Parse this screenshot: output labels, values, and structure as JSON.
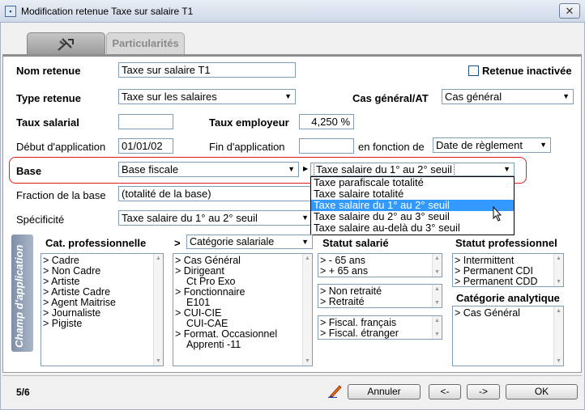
{
  "window": {
    "title": "Modification retenue Taxe sur salaire T1",
    "close_glyph": "✕"
  },
  "tabs": [
    {
      "label": "",
      "icon": "tool-icon"
    },
    {
      "label": "Particularités"
    }
  ],
  "form": {
    "nom_retenue_label": "Nom retenue",
    "nom_retenue_value": "Taxe sur salaire T1",
    "retenue_inactivee_label": "Retenue inactivée",
    "type_retenue_label": "Type retenue",
    "type_retenue_value": "Taxe sur les salaires",
    "cas_general_label": "Cas général/AT",
    "cas_general_value": "Cas général",
    "taux_salarial_label": "Taux salarial",
    "taux_salarial_value": "",
    "taux_employeur_label": "Taux employeur",
    "taux_employeur_value": "4,250 %",
    "debut_label": "Début d'application",
    "debut_value": "01/01/02",
    "fin_label": "Fin d'application",
    "fin_value": "",
    "en_fonction_label": "en fonction de",
    "en_fonction_value": "Date de règlement",
    "base_label": "Base",
    "base_value": "Base fiscale",
    "seuil_value": "Taxe salaire du 1° au 2° seuil",
    "fraction_label": "Fraction de la base",
    "fraction_value": "(totalité de la base)",
    "specificite_label": "Spécificité",
    "specificite_value": "Taxe salaire du 1° au 2° seuil"
  },
  "dropdown": {
    "items": [
      "Taxe parafiscale totalité",
      "Taxe salaire totalité",
      "Taxe salaire du 1° au 2° seuil",
      "Taxe salaire du 2° au 3° seuil",
      "Taxe salaire au-delà du 3° seuil"
    ],
    "selected_index": 2
  },
  "champ": {
    "label": "Champ d'application",
    "cat_pro_label": "Cat. professionnelle",
    "cat_pro_items": [
      "> Cadre",
      "> Non Cadre",
      "> Artiste",
      "> Artiste Cadre",
      "> Agent Maitrise",
      "> Journaliste",
      "> Pigiste"
    ],
    "cat_sal_arrow": ">",
    "cat_sal_select": "Catégorie salariale",
    "cat_sal_items": [
      "> Cas Général",
      "> Dirigeant",
      "Ct Pro Exo",
      "> Fonctionnaire",
      "E101",
      "> CUI-CIE",
      "CUI-CAE",
      "> Format. Occasionnel",
      "Apprenti -11"
    ],
    "statut_salarie_label": "Statut salarié",
    "statut_age_items": [
      ">  - 65 ans",
      ">  + 65 ans"
    ],
    "statut_retraite_items": [
      "> Non retraité",
      "> Retraité"
    ],
    "statut_fiscal_items": [
      "> Fiscal. français",
      "> Fiscal. étranger"
    ],
    "statut_pro_label": "Statut professionnel",
    "statut_pro_items": [
      "> Intermittent",
      "> Permanent CDI",
      "> Permanent CDD"
    ],
    "cat_analytique_label": "Catégorie analytique",
    "cat_analytique_items": [
      "> Cas Général"
    ]
  },
  "footer": {
    "page": "5/6",
    "annuler": "Annuler",
    "prev": "<-",
    "next": "->",
    "ok": "OK"
  }
}
